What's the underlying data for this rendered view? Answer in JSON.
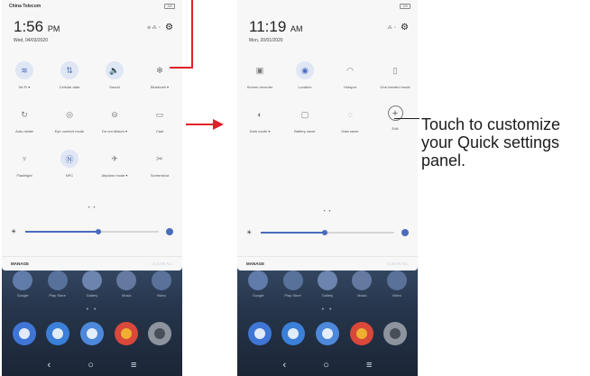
{
  "left_screen": {
    "carrier": "China Telecom",
    "battery": "100",
    "time": "1:56",
    "ampm": "PM",
    "date": "Wed, 04/03/2020",
    "status_icons": "⊕ ⁂ ◔",
    "tiles": [
      {
        "icon": "wifi-icon",
        "glyph": "≋",
        "label": "Wi-Fi ▾",
        "on": true
      },
      {
        "icon": "data-icon",
        "glyph": "⇅",
        "label": "Cellular data",
        "on": true
      },
      {
        "icon": "sound-icon",
        "glyph": "🔈",
        "label": "Sound",
        "on": true
      },
      {
        "icon": "bluetooth-icon",
        "glyph": "✻",
        "label": "Bluetooth ▾",
        "on": false
      },
      {
        "icon": "rotate-icon",
        "glyph": "↻",
        "label": "Auto-rotate",
        "on": false
      },
      {
        "icon": "eye-icon",
        "glyph": "◎",
        "label": "Eye comfort mode",
        "on": false
      },
      {
        "icon": "dnd-icon",
        "glyph": "⊖",
        "label": "Do not disturb ▾",
        "on": false
      },
      {
        "icon": "cast-icon",
        "glyph": "▭",
        "label": "Cast",
        "on": false
      },
      {
        "icon": "flashlight-icon",
        "glyph": "♆",
        "label": "Flashlight",
        "on": false
      },
      {
        "icon": "nfc-icon",
        "glyph": "Ⓝ",
        "label": "NFC",
        "on": true
      },
      {
        "icon": "airplane-icon",
        "glyph": "✈",
        "label": "Airplane mode ▾",
        "on": false
      },
      {
        "icon": "screenshot-icon",
        "glyph": "✂",
        "label": "Screenshot",
        "on": false
      }
    ],
    "brightness": 0.55,
    "manage": "MANAGE",
    "clear_all": "CLEAR ALL",
    "apps": [
      "Google",
      "Play Store",
      "Gallery",
      "Music",
      "Video"
    ]
  },
  "right_screen": {
    "battery": "100",
    "time": "11:19",
    "ampm": "AM",
    "date": "Mon, 20/01/2020",
    "status_icons": "⁂ ◔",
    "tiles": [
      {
        "icon": "screen-record-icon",
        "glyph": "▣",
        "label": "Screen recorder",
        "on": false
      },
      {
        "icon": "location-icon",
        "glyph": "◉",
        "label": "Location",
        "on": true
      },
      {
        "icon": "hotspot-icon",
        "glyph": "◠",
        "label": "Hotspot",
        "on": false
      },
      {
        "icon": "one-hand-icon",
        "glyph": "▯",
        "label": "One-handed mode",
        "on": false
      },
      {
        "icon": "dark-mode-icon",
        "glyph": "◐",
        "label": "Dark mode ▾",
        "on": false
      },
      {
        "icon": "battery-saver-icon",
        "glyph": "▢",
        "label": "Battery saver",
        "on": false
      },
      {
        "icon": "data-saver-icon",
        "glyph": "◌",
        "label": "Data saver",
        "on": false
      },
      {
        "icon": "edit-icon",
        "glyph": "+",
        "label": "Edit",
        "on": false,
        "outline": true
      }
    ],
    "brightness": 0.48,
    "manage": "MANAGE",
    "clear_all": "CLEAR ALL",
    "apps": [
      "Google",
      "Play Store",
      "Gallery",
      "Music",
      "Video"
    ]
  },
  "nav": {
    "back": "‹",
    "home": "○",
    "recent": "≡"
  },
  "annotation": "Touch to customize your Quick settings panel.",
  "colors": {
    "accent": "#4a6bbd",
    "arrow": "#e0202a"
  }
}
